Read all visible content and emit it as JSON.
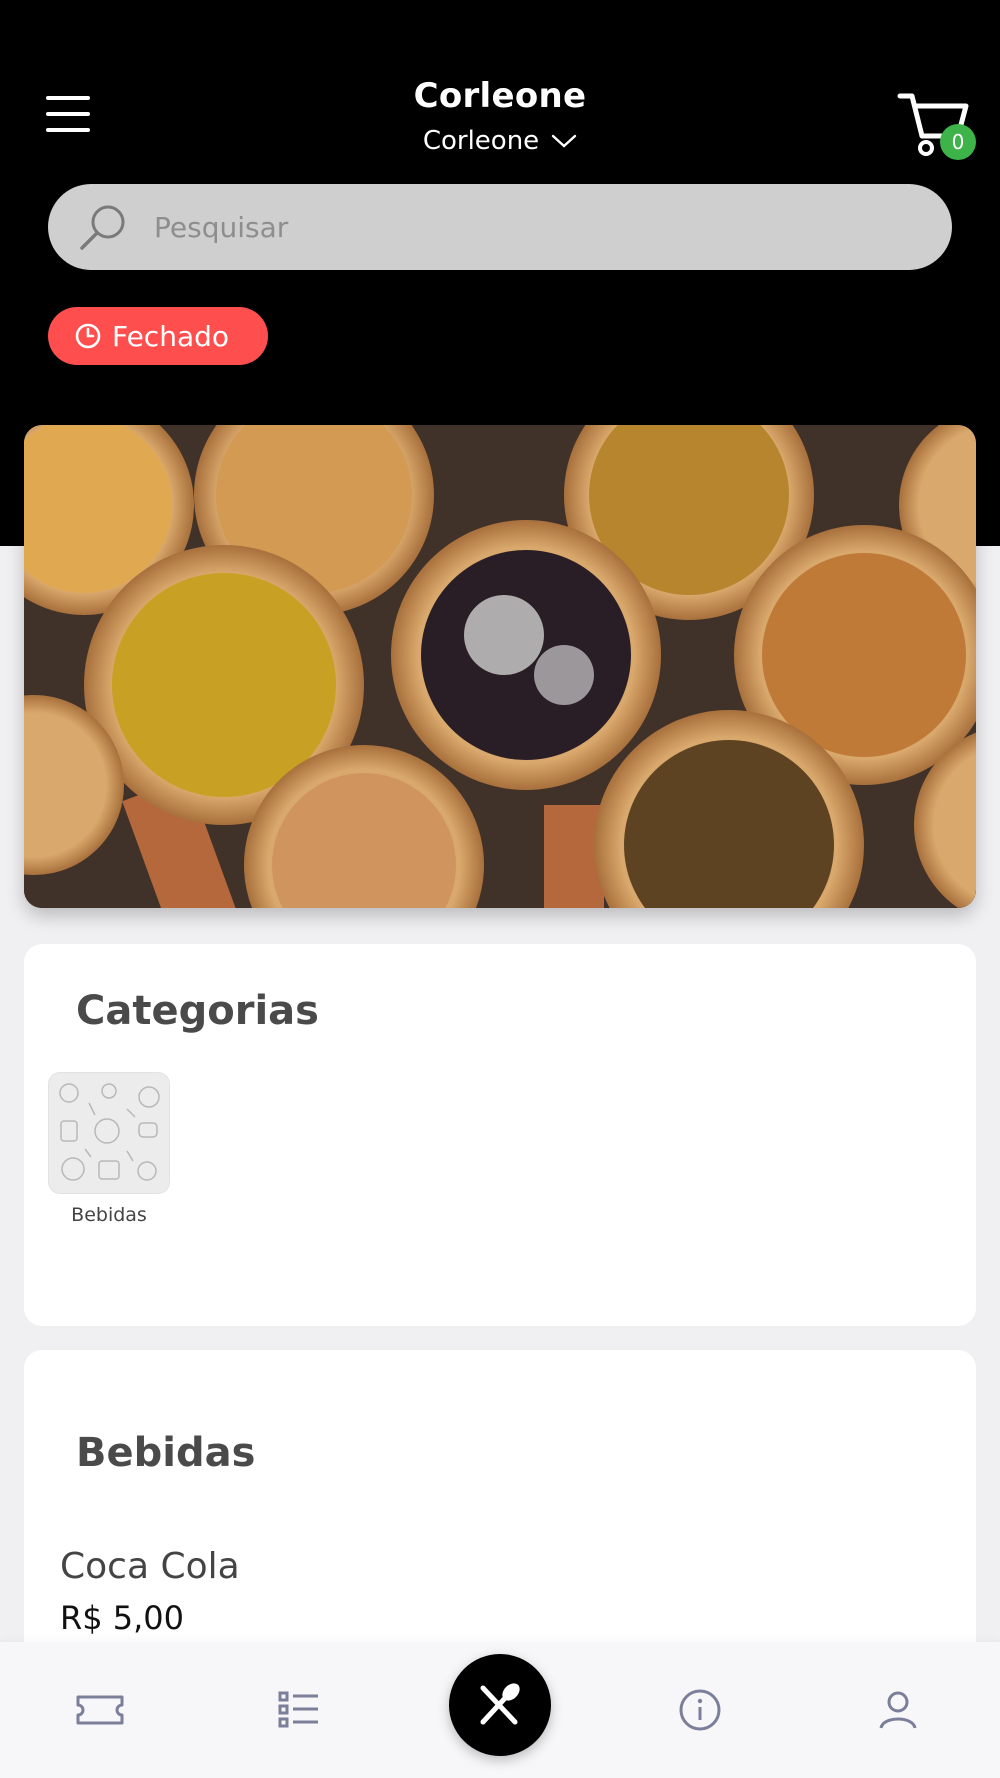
{
  "header": {
    "title": "Corleone",
    "store_selector": "Corleone",
    "cart_count": "0"
  },
  "search": {
    "placeholder": "Pesquisar"
  },
  "status": {
    "label": "Fechado",
    "color": "#ff4e4e"
  },
  "categories": {
    "title": "Categorias",
    "items": [
      {
        "label": "Bebidas"
      }
    ]
  },
  "products_section": {
    "title": "Bebidas",
    "items": [
      {
        "name": "Coca Cola",
        "price": "R$ 5,00"
      }
    ]
  },
  "bottom_nav": {
    "items": [
      {
        "icon": "ticket-icon"
      },
      {
        "icon": "list-icon"
      },
      {
        "icon": "fork-spoon-icon",
        "active": true
      },
      {
        "icon": "info-icon"
      },
      {
        "icon": "user-icon"
      }
    ]
  },
  "colors": {
    "accent_green": "#3db34a",
    "header_bg": "#000000"
  }
}
